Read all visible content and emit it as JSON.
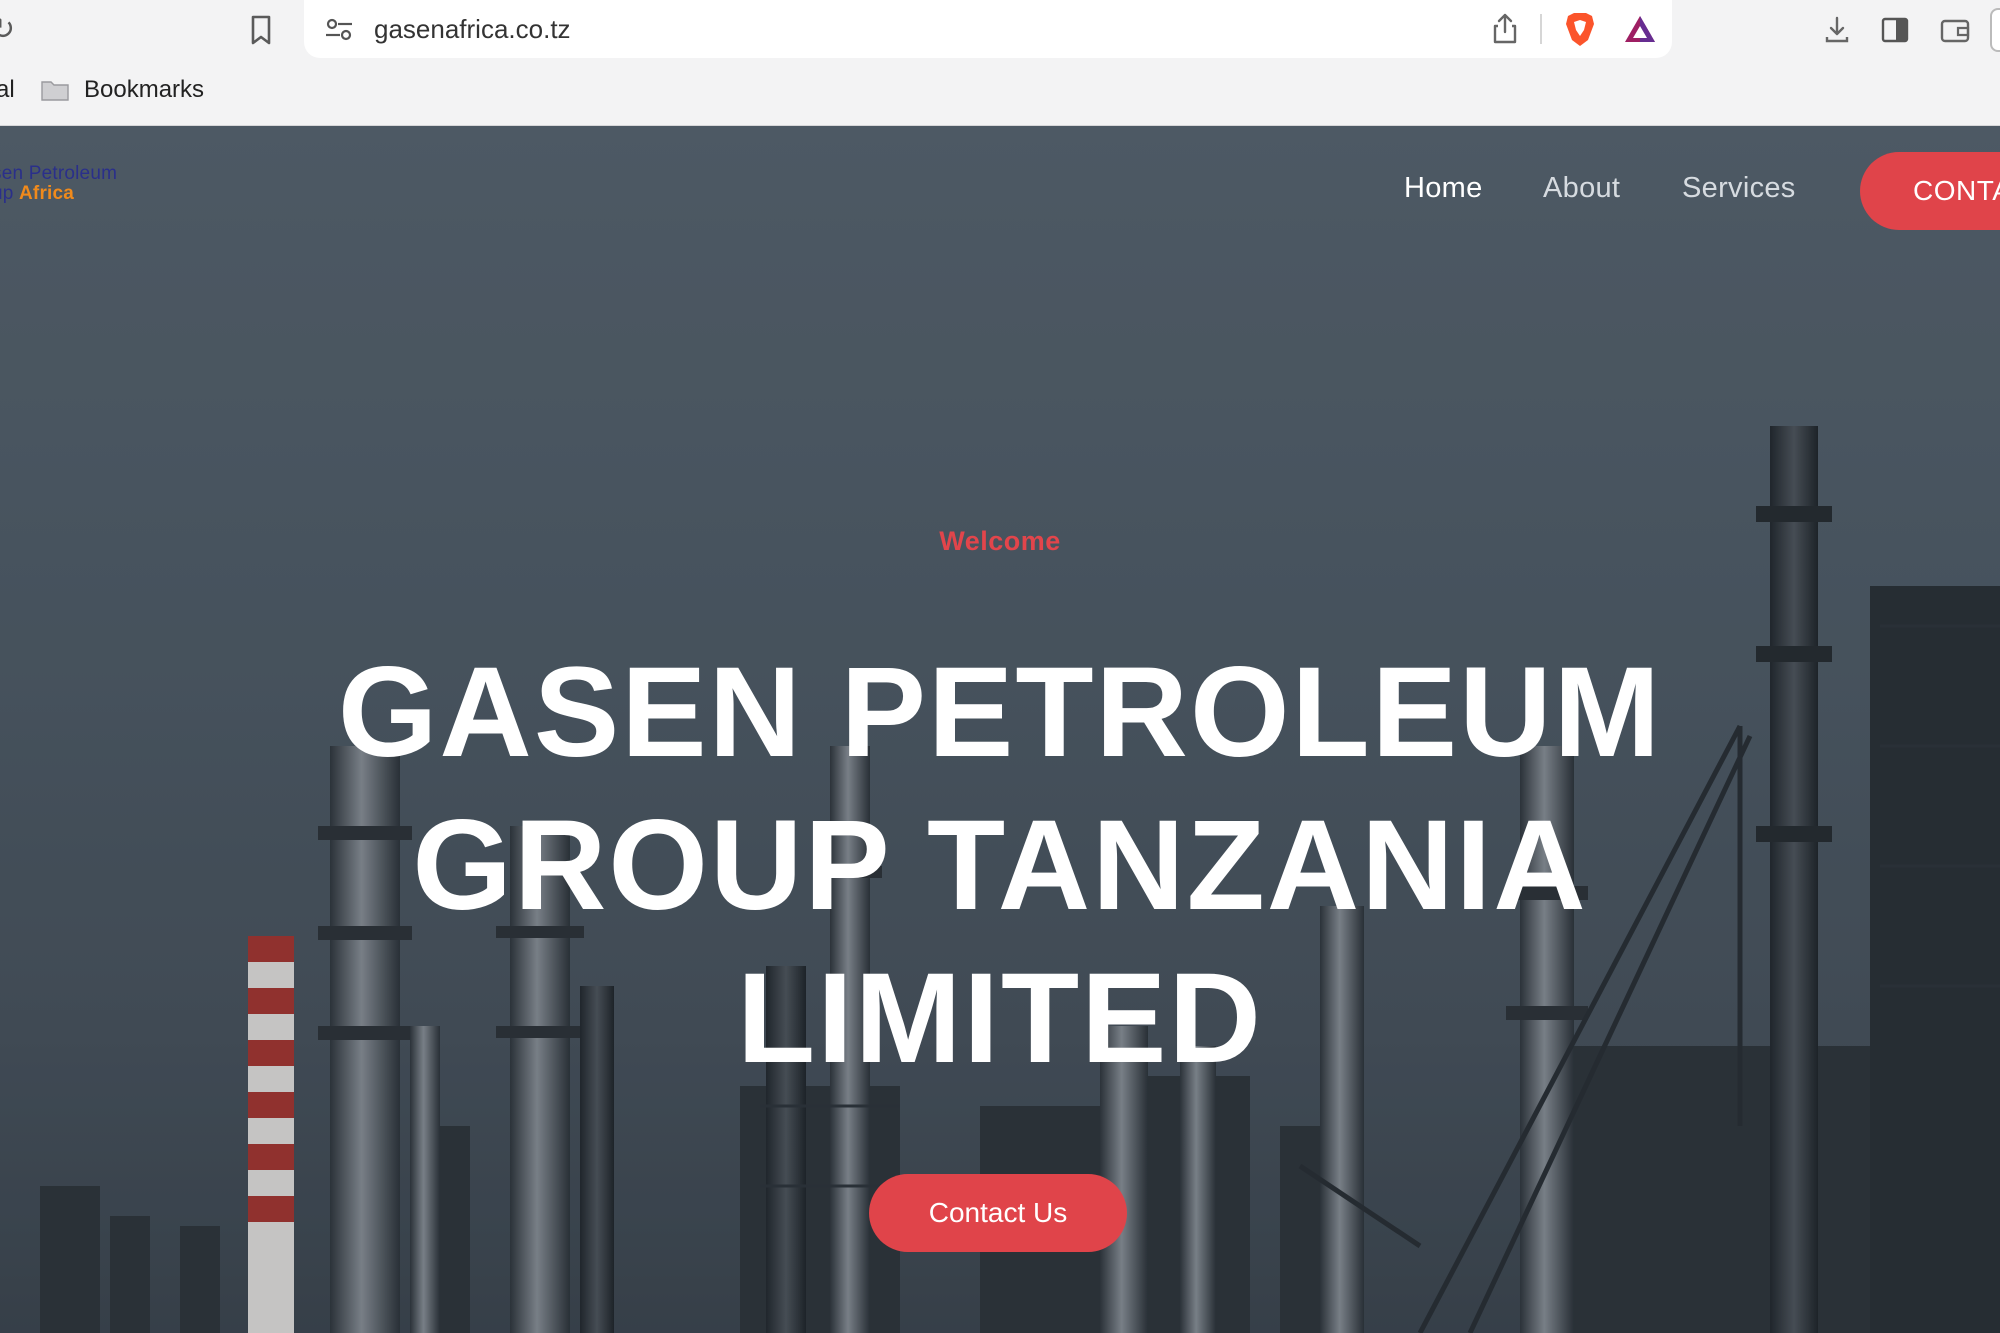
{
  "browser": {
    "url": "gasenafrica.co.tz",
    "bookmarks": [
      {
        "label": "al"
      },
      {
        "label": "Bookmarks"
      }
    ]
  },
  "site": {
    "logo": {
      "line1": "sen Petroleum",
      "line2_part1": "up ",
      "line2_part2": "Africa",
      "brand_color_primary": "#2a2f8a",
      "brand_color_accent": "#f08a1c"
    },
    "nav": {
      "items": [
        {
          "label": "Home",
          "active": true
        },
        {
          "label": "About",
          "active": false
        },
        {
          "label": "Services",
          "active": false
        }
      ],
      "cta_label": "CONTA"
    },
    "hero": {
      "welcome": "Welcome",
      "headline_lines": [
        "GASEN PETROLEUM",
        "GROUP TANZANIA",
        "LIMITED"
      ],
      "cta_label": "Contact Us"
    },
    "colors": {
      "accent": "#e0444a",
      "nav_text": "#d6dbe0",
      "headline": "#ffffff"
    }
  }
}
